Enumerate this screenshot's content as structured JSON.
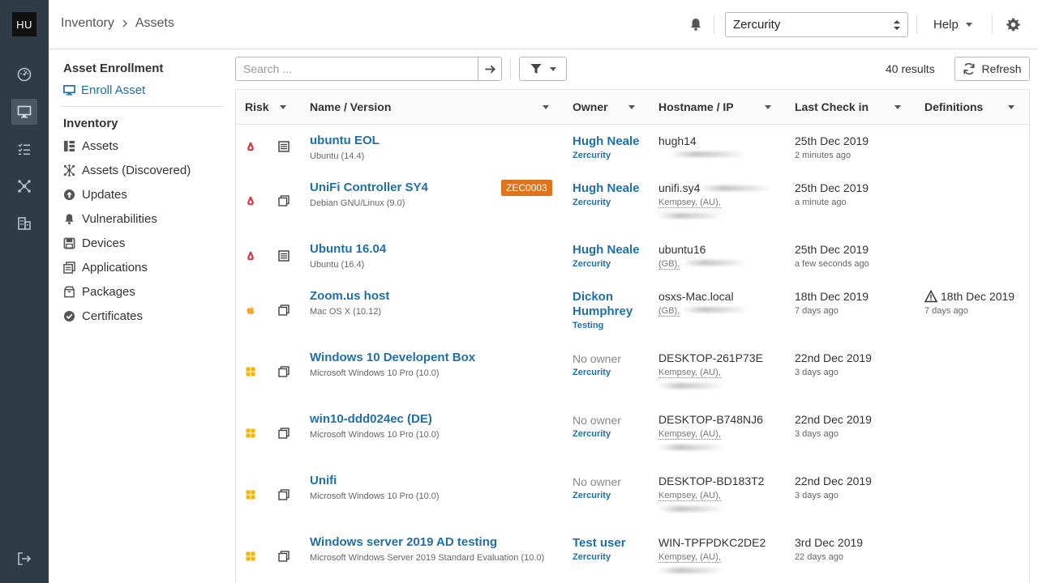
{
  "user": {
    "initials": "HU"
  },
  "breadcrumb": {
    "root": "Inventory",
    "current": "Assets"
  },
  "header": {
    "org_select": "Zercurity",
    "help_label": "Help"
  },
  "subnav": {
    "enrollment_heading": "Asset Enrollment",
    "enroll_label": "Enroll Asset",
    "inventory_heading": "Inventory",
    "items": [
      {
        "label": "Assets",
        "icon": "assets-icon"
      },
      {
        "label": "Assets (Discovered)",
        "icon": "discovered-icon"
      },
      {
        "label": "Updates",
        "icon": "update-icon"
      },
      {
        "label": "Vulnerabilities",
        "icon": "bell-icon"
      },
      {
        "label": "Devices",
        "icon": "device-icon"
      },
      {
        "label": "Applications",
        "icon": "applications-icon"
      },
      {
        "label": "Packages",
        "icon": "package-icon"
      },
      {
        "label": "Certificates",
        "icon": "certificate-icon"
      }
    ]
  },
  "toolbar": {
    "search_placeholder": "Search ...",
    "results": "40 results",
    "refresh_label": "Refresh"
  },
  "table": {
    "columns": [
      "Risk",
      "Name / Version",
      "Owner",
      "Hostname / IP",
      "Last Check in",
      "Definitions"
    ],
    "rows": [
      {
        "name": "ubuntu EOL",
        "version": "Ubuntu (14.4)",
        "os": "linux",
        "type": "server",
        "tag": "",
        "owner": "Hugh Neale",
        "team": "Zercurity",
        "host": "hugh14",
        "location": "",
        "date": "25th Dec 2019",
        "ago": "2 minutes ago",
        "definitions": "",
        "definitions_ago": ""
      },
      {
        "name": "UniFi Controller SY4",
        "version": "Debian GNU/Linux (9.0)",
        "os": "linux",
        "type": "vm",
        "tag": "ZEC0003",
        "owner": "Hugh Neale",
        "team": "Zercurity",
        "host": "unifi.sy4",
        "location": "Kempsey, (AU),",
        "date": "25th Dec 2019",
        "ago": "a minute ago",
        "definitions": "",
        "definitions_ago": ""
      },
      {
        "name": "Ubuntu 16.04",
        "version": "Ubuntu (16.4)",
        "os": "linux",
        "type": "server",
        "tag": "",
        "owner": "Hugh Neale",
        "team": "Zercurity",
        "host": "ubuntu16",
        "location": "(GB),",
        "date": "25th Dec 2019",
        "ago": "a few seconds ago",
        "definitions": "",
        "definitions_ago": ""
      },
      {
        "name": "Zoom.us host",
        "version": "Mac OS X (10.12)",
        "os": "apple",
        "type": "vm",
        "tag": "",
        "owner": "Dickon Humphrey",
        "team": "Testing",
        "host": "osxs-Mac.local",
        "location": "(GB),",
        "date": "18th Dec 2019",
        "ago": "7 days ago",
        "definitions": "18th Dec 2019",
        "definitions_ago": "7 days ago"
      },
      {
        "name": "Windows 10 Developent Box",
        "version": "Microsoft Windows 10 Pro (10.0)",
        "os": "windows",
        "type": "vm",
        "tag": "",
        "owner": "No owner",
        "team": "Zercurity",
        "host": "DESKTOP-261P73E",
        "location": "Kempsey, (AU),",
        "date": "22nd Dec 2019",
        "ago": "3 days ago",
        "definitions": "",
        "definitions_ago": ""
      },
      {
        "name": "win10-ddd024ec (DE)",
        "version": "Microsoft Windows 10 Pro (10.0)",
        "os": "windows",
        "type": "vm",
        "tag": "",
        "owner": "No owner",
        "team": "Zercurity",
        "host": "DESKTOP-B748NJ6",
        "location": "Kempsey, (AU),",
        "date": "22nd Dec 2019",
        "ago": "3 days ago",
        "definitions": "",
        "definitions_ago": ""
      },
      {
        "name": "Unifi",
        "version": "Microsoft Windows 10 Pro (10.0)",
        "os": "windows",
        "type": "vm",
        "tag": "",
        "owner": "No owner",
        "team": "Zercurity",
        "host": "DESKTOP-BD183T2",
        "location": "Kempsey, (AU),",
        "date": "22nd Dec 2019",
        "ago": "3 days ago",
        "definitions": "",
        "definitions_ago": ""
      },
      {
        "name": "Windows server 2019 AD testing",
        "version": "Microsoft Windows Server 2019 Standard Evaluation (10.0)",
        "os": "windows",
        "type": "vm",
        "tag": "",
        "owner": "Test user",
        "team": "Zercurity",
        "host": "WIN-TPFPDKC2DE2",
        "location": "Kempsey, (AU),",
        "date": "3rd Dec 2019",
        "ago": "22 days ago",
        "definitions": "",
        "definitions_ago": ""
      }
    ]
  },
  "colors": {
    "rail": "#2f3c48",
    "link": "#1f6fa8",
    "tag": "#e0741d",
    "linux_risk": "#d9363e",
    "apple": "#f5a623",
    "windows": "#f5b400"
  }
}
